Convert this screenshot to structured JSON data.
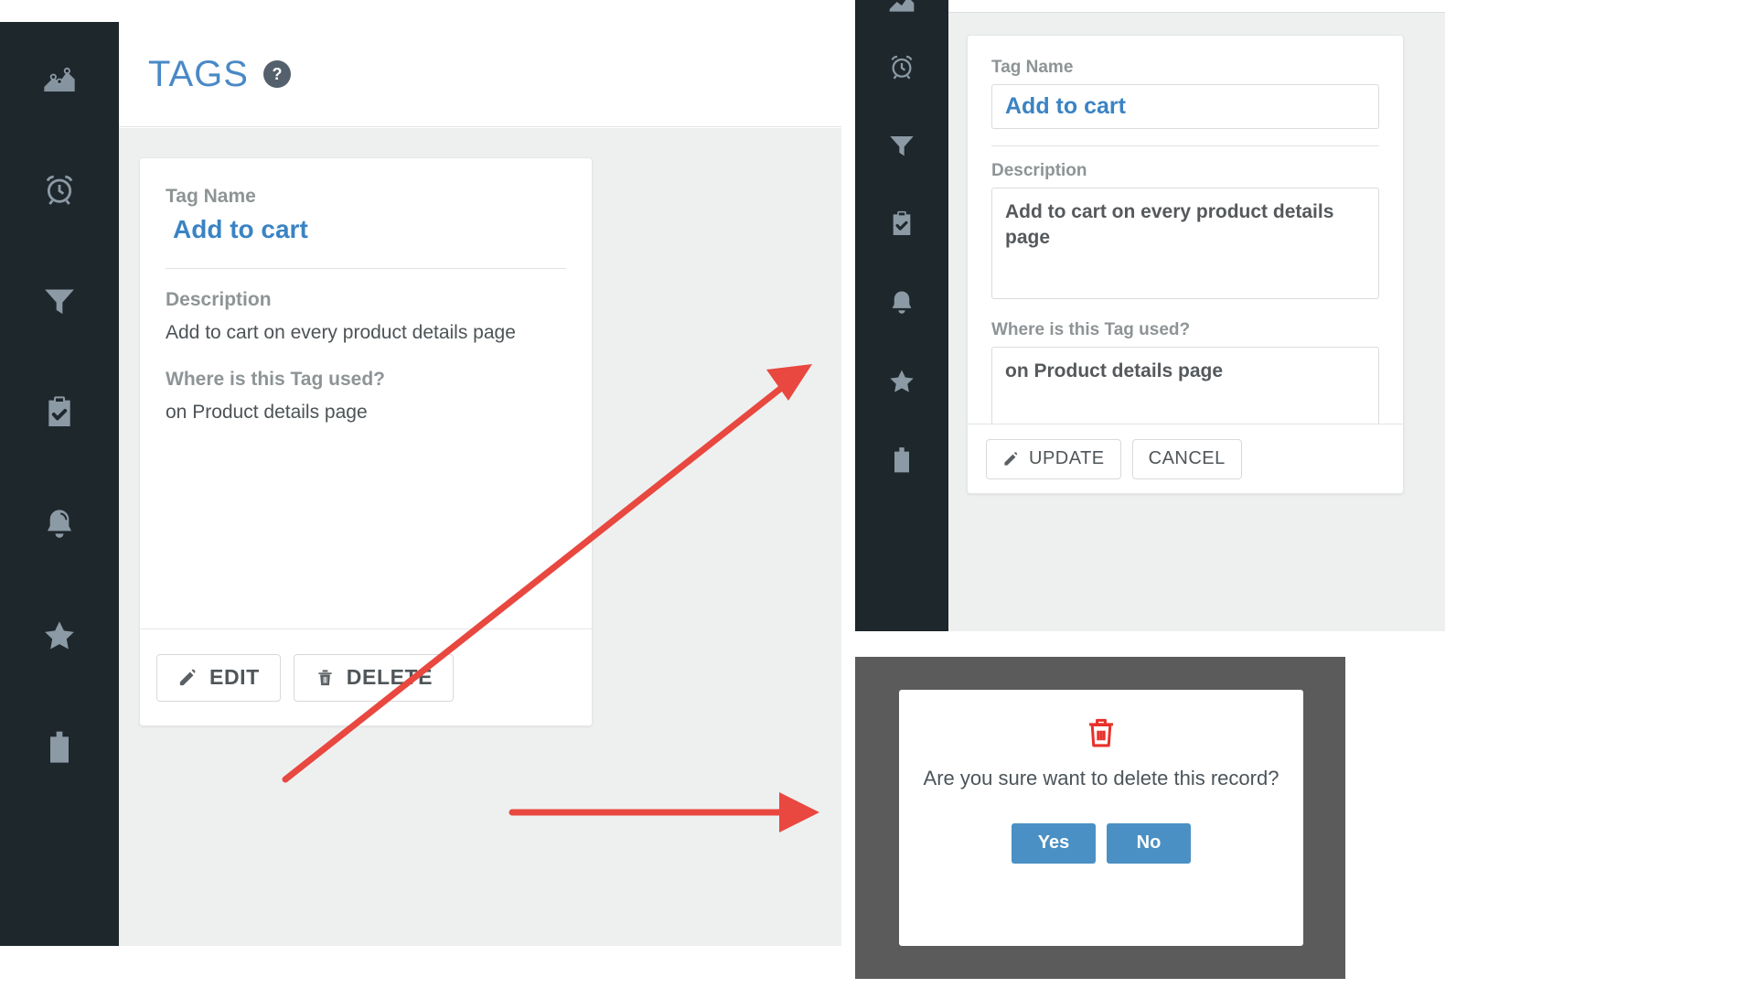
{
  "sidebar": {
    "items": [
      {
        "icon": "analytics-chart-icon",
        "name": "analytics"
      },
      {
        "icon": "alarm-clock-icon",
        "name": "alerts"
      },
      {
        "icon": "funnel-filter-icon",
        "name": "filters"
      },
      {
        "icon": "clipboard-check-icon",
        "name": "tasks"
      },
      {
        "icon": "bell-icon",
        "name": "notifications"
      },
      {
        "icon": "star-icon",
        "name": "favorites"
      },
      {
        "icon": "paste-clipboard-icon",
        "name": "clipboard"
      }
    ]
  },
  "page": {
    "title": "TAGS",
    "help_label": "?"
  },
  "tag_card": {
    "tag_name_label": "Tag Name",
    "tag_name_value": "Add to cart",
    "description_label": "Description",
    "description_value": "Add to cart on every product details page",
    "usage_label": "Where is this Tag used?",
    "usage_value": "on Product details page",
    "edit_button": "EDIT",
    "delete_button": "DELETE"
  },
  "edit_form": {
    "tag_name_label": "Tag Name",
    "tag_name_value": "Add to cart",
    "description_label": "Description",
    "description_value": "Add to cart on every product details page",
    "usage_label": "Where is this Tag used?",
    "usage_value": "on Product details page",
    "update_button": "UPDATE",
    "cancel_button": "CANCEL"
  },
  "delete_dialog": {
    "icon": "trash-icon",
    "message": "Are you sure want to delete this record?",
    "yes_button": "Yes",
    "no_button": "No"
  },
  "colors": {
    "sidebar_bg": "#1e272c",
    "title_blue": "#4a89c6",
    "value_blue": "#3a83c4",
    "page_bg": "#eef0f0",
    "annotation_red": "#e8483f",
    "modal_overlay": "#5b5b5b",
    "button_blue": "#4a90c4",
    "trash_red": "#e8312a"
  }
}
